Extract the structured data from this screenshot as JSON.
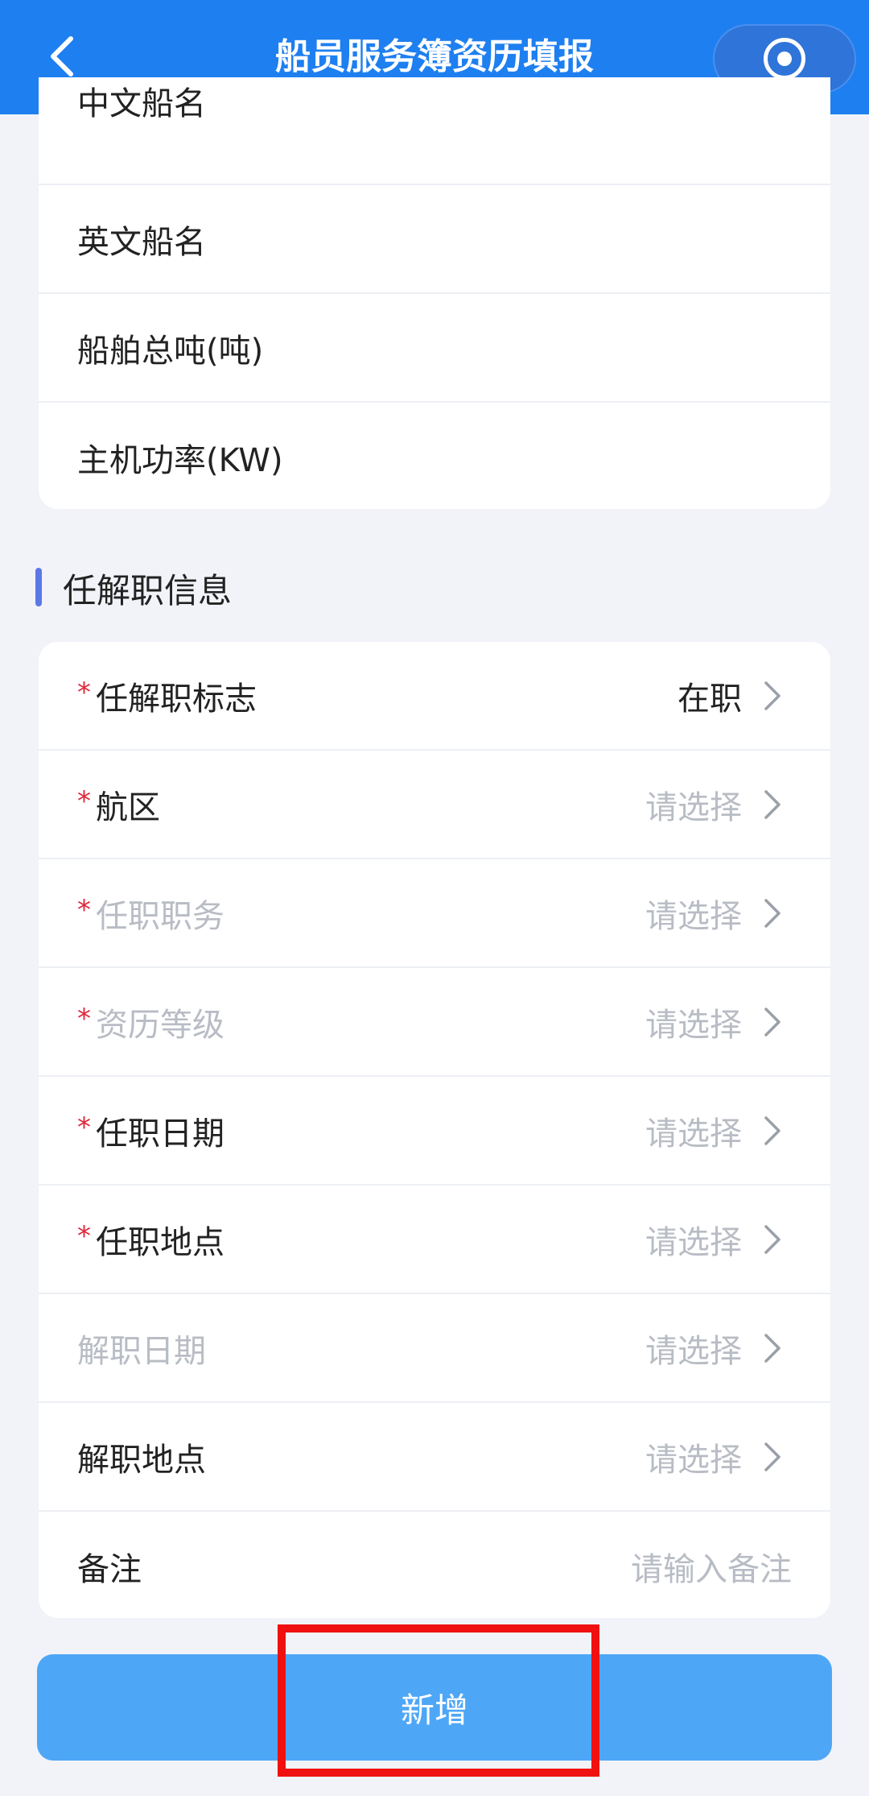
{
  "header": {
    "title": "船员服务簿资历填报"
  },
  "vessel_info": {
    "fields": [
      {
        "label": "中文船名"
      },
      {
        "label": "英文船名"
      },
      {
        "label": "船舶总吨(吨)"
      },
      {
        "label": "主机功率(KW)"
      }
    ]
  },
  "section": {
    "title": "任解职信息"
  },
  "position_info": {
    "required_mark": "*",
    "fields": [
      {
        "label": "任解职标志",
        "value": "在职"
      },
      {
        "label": "航区",
        "placeholder": "请选择"
      },
      {
        "label": "任职职务",
        "placeholder": "请选择"
      },
      {
        "label": "资历等级",
        "placeholder": "请选择"
      },
      {
        "label": "任职日期",
        "placeholder": "请选择"
      },
      {
        "label": "任职地点",
        "placeholder": "请选择"
      },
      {
        "label": "解职日期",
        "placeholder": "请选择"
      },
      {
        "label": "解职地点",
        "placeholder": "请选择"
      },
      {
        "label": "备注",
        "placeholder": "请输入备注"
      }
    ]
  },
  "actions": {
    "add_label": "新增"
  },
  "colors": {
    "header_bg": "#1e7ff0",
    "button_bg": "#4ea6f6",
    "required": "#e0283c",
    "highlight": "#f01010"
  }
}
